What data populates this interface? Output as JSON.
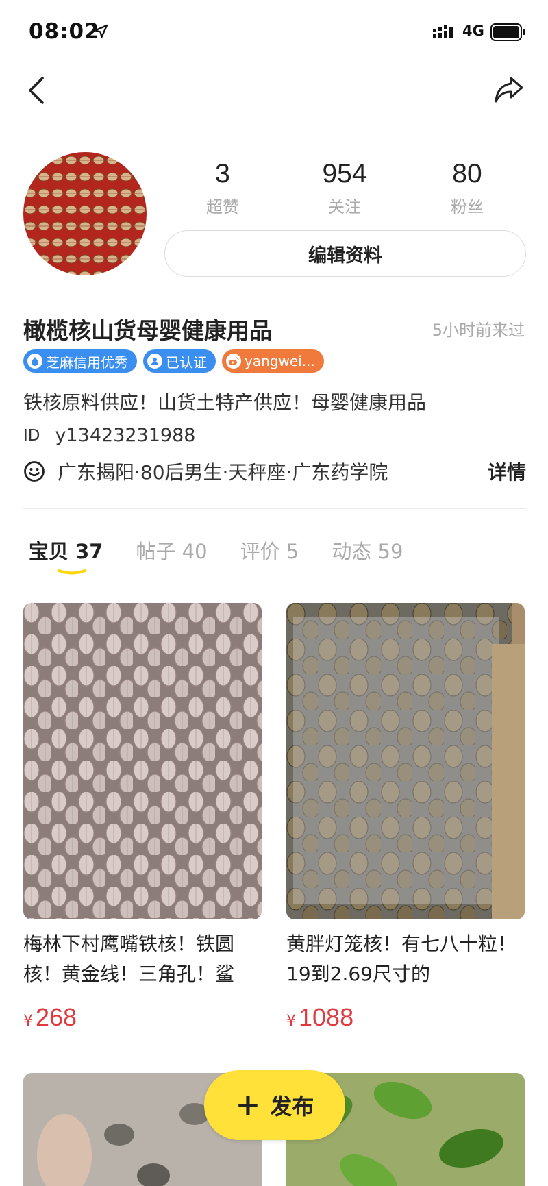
{
  "status_bar": {
    "time": "08:02",
    "network": "4G"
  },
  "profile": {
    "stats": [
      {
        "value": "3",
        "label": "超赞"
      },
      {
        "value": "954",
        "label": "关注"
      },
      {
        "value": "80",
        "label": "粉丝"
      }
    ],
    "edit_label": "编辑资料",
    "name": "橄榄核山货母婴健康用品",
    "last_seen": "5小时前来过",
    "badges": [
      {
        "label": "芝麻信用优秀",
        "color": "#3a8ef0"
      },
      {
        "label": "已认证",
        "color": "#3a8ef0"
      },
      {
        "label": "yangwei...",
        "color": "#f07a3c"
      }
    ],
    "bio": "铁核原料供应！山货土特产供应！母婴健康用品",
    "id_label": "ID",
    "id_value": "y13423231988",
    "info": "广东揭阳·80后男生·天秤座·广东药学院",
    "detail_label": "详情"
  },
  "tabs": [
    {
      "label": "宝贝",
      "count": "37"
    },
    {
      "label": "帖子",
      "count": "40"
    },
    {
      "label": "评价",
      "count": "5"
    },
    {
      "label": "动态",
      "count": "59"
    }
  ],
  "products": [
    {
      "title": "梅林下村鹰嘴铁核！铁圆核！黄金线！三角孔！鲨",
      "currency": "¥",
      "price": "268"
    },
    {
      "title": "黄胖灯笼核！有七八十粒！19到2.69尺寸的",
      "currency": "¥",
      "price": "1088"
    }
  ],
  "publish": {
    "label": "发布"
  },
  "colors": {
    "price": "#e0393e",
    "accent": "#ffe13a",
    "badge_blue": "#3a8ef0",
    "badge_orange": "#f07a3c"
  }
}
